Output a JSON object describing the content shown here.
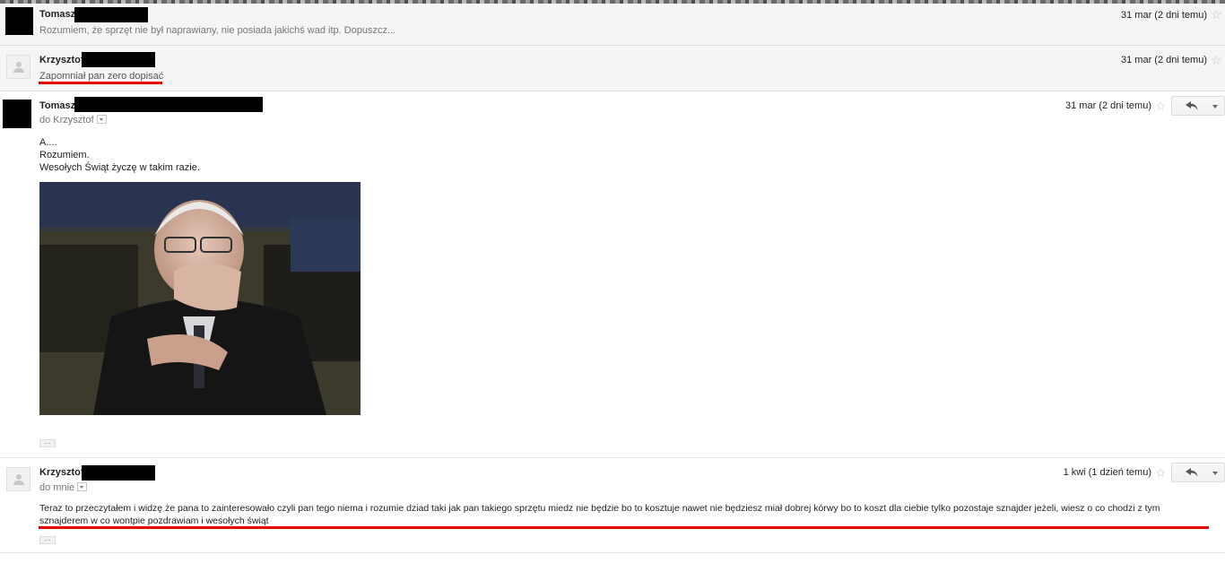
{
  "messages": [
    {
      "sender": "Tomasz",
      "snippet": "Rozumiem, że sprzęt nie był naprawiany, nie posiada jakichś wad itp. Dopuszcz...",
      "date": "31 mar (2 dni temu)",
      "state": "collapsed"
    },
    {
      "sender": "Krzysztof",
      "snippet": "Zapomniał pan zero dopisać",
      "date": "31 mar (2 dni temu)",
      "state": "collapsed"
    },
    {
      "sender": "Tomasz",
      "to": "do Krzysztof",
      "date": "31 mar (2 dni temu)",
      "state": "expanded",
      "body": [
        "A....",
        "Rozumiem.",
        "Wesołych Świąt życzę w takim razie."
      ],
      "ellipsis": "..."
    },
    {
      "sender": "Krzysztof",
      "to": "do mnie",
      "date": "1 kwi (1 dzień temu)",
      "state": "expanded",
      "body_line1": "Teraz to przeczytałem i widzę że pana to zainteresowało czyli pan tego niema i rozumie dziad taki jak pan takiego sprzętu miedz nie będzie bo to kosztuje nawet nie będziesz miał dobrej kórwy bo to koszt dla ciebie tylko pozostaje sznajder jeżeli, wiesz  o co chodzi z tym",
      "body_line2": "sznajderem w co wontpie pozdrawiam i wesołych świąt",
      "ellipsis": "..."
    }
  ],
  "icons": {
    "star": "☆",
    "reply": "reply-arrow"
  },
  "colors": {
    "annotation_red": "#e00000",
    "collapsed_bg": "#f5f5f5"
  }
}
